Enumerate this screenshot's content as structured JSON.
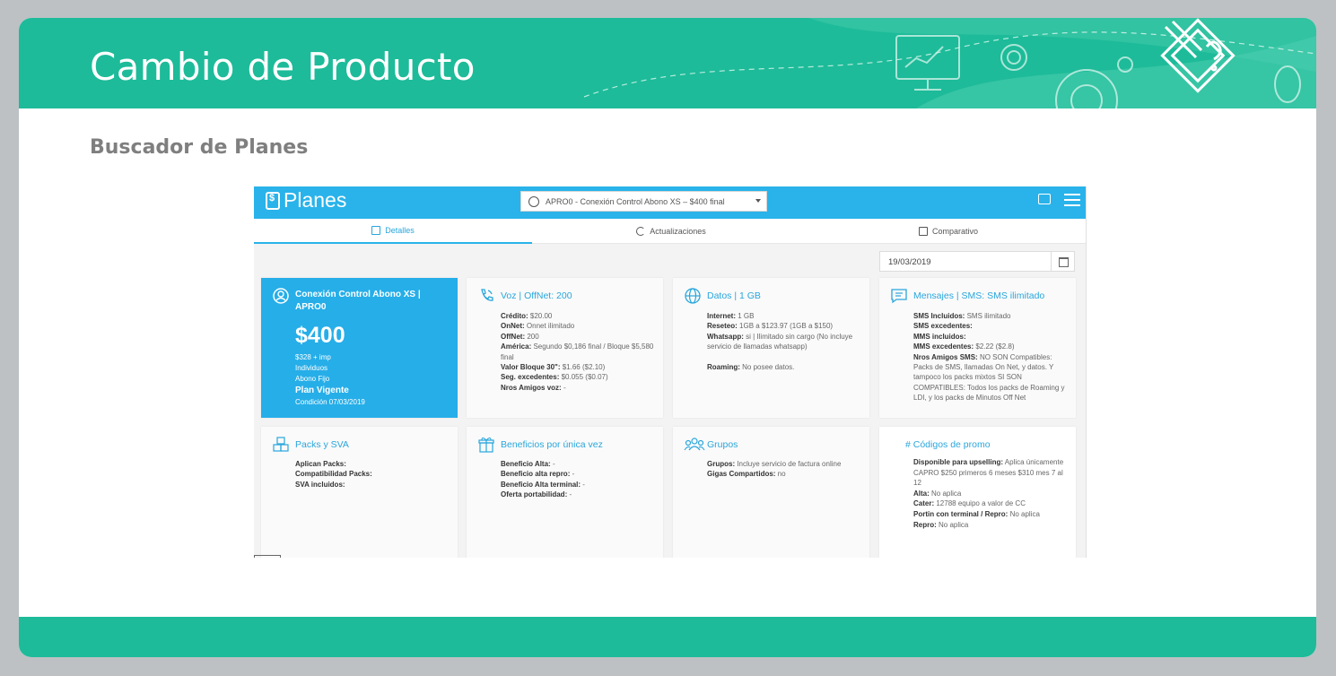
{
  "slide": {
    "title": "Cambio de Producto",
    "subtitle": "Buscador de Planes"
  },
  "app": {
    "brand": "Planes",
    "plan_select": "APRO0 - Conexión Control Abono XS – $400 final",
    "tabs": [
      {
        "label": "Detalles",
        "active": true
      },
      {
        "label": "Actualizaciones",
        "active": false
      },
      {
        "label": "Comparativo",
        "active": false
      }
    ],
    "date": "19/03/2019",
    "plan": {
      "name": "Conexión Control Abono XS | APRO0",
      "price": "$400",
      "net": "$328 + imp",
      "segment": "Individuos",
      "type": "Abono Fijo",
      "status": "Plan Vigente",
      "condition": "Condición 07/03/2019"
    },
    "voz": {
      "title": "Voz | OffNet: 200",
      "rows": [
        {
          "k": "Crédito:",
          "v": " $20.00"
        },
        {
          "k": "OnNet:",
          "v": " Onnet ilimitado"
        },
        {
          "k": "OffNet:",
          "v": " 200"
        },
        {
          "k": "América:",
          "v": " Segundo $0,186 final / Bloque $5,580 final"
        },
        {
          "k": "Valor Bloque 30\":",
          "v": " $1.66 ($2.10)"
        },
        {
          "k": "Seg. excedentes:",
          "v": " $0.055 ($0.07)"
        },
        {
          "k": "Nros Amigos voz:",
          "v": " -"
        }
      ]
    },
    "datos": {
      "title": "Datos | 1 GB",
      "rows": [
        {
          "k": "Internet:",
          "v": " 1 GB"
        },
        {
          "k": "Reseteo:",
          "v": " 1GB a $123.97 (1GB a $150)"
        },
        {
          "k": "Whatsapp:",
          "v": " si | Ilimitado sin cargo (No incluye servicio de llamadas whatsapp)"
        },
        {
          "k": "Roaming:",
          "v": " No posee datos."
        }
      ]
    },
    "mensajes": {
      "title": "Mensajes | SMS: SMS ilimitado",
      "rows": [
        {
          "k": "SMS Incluidos:",
          "v": " SMS ilimitado"
        },
        {
          "k": "SMS excedentes:",
          "v": ""
        },
        {
          "k": "MMS incluidos:",
          "v": ""
        },
        {
          "k": "MMS excedentes:",
          "v": " $2.22 ($2.8)"
        },
        {
          "k": "Nros Amigos SMS:",
          "v": " NO SON Compatibles: Packs de SMS, llamadas On Net, y datos. Y tampoco los packs mixtos SI SON COMPATIBLES: Todos los packs de Roaming y LDI, y los packs de Minutos Off Net"
        }
      ]
    },
    "packs": {
      "title": "Packs y SVA",
      "rows": [
        {
          "k": "Aplican Packs:",
          "v": ""
        },
        {
          "k": "Compatibilidad Packs:",
          "v": ""
        },
        {
          "k": "SVA incluidos:",
          "v": ""
        }
      ]
    },
    "beneficios": {
      "title": "Beneficios por única vez",
      "rows": [
        {
          "k": "Beneficio Alta:",
          "v": " -"
        },
        {
          "k": "Beneficio alta repro:",
          "v": " -"
        },
        {
          "k": "Beneficio Alta terminal:",
          "v": " -"
        },
        {
          "k": "Oferta portabilidad:",
          "v": " -"
        }
      ]
    },
    "grupos": {
      "title": "Grupos",
      "rows": [
        {
          "k": "Grupos:",
          "v": " Incluye servicio de factura online"
        },
        {
          "k": "Gigas Compartidos:",
          "v": " no"
        }
      ]
    },
    "promo": {
      "title": "# Códigos de promo",
      "rows": [
        {
          "k": "Disponible para upselling:",
          "v": " Aplica únicamente CAPRO $250 primeros 6 meses $310 mes 7 al 12"
        },
        {
          "k": "Alta:",
          "v": " No aplica"
        },
        {
          "k": "Cater:",
          "v": " 12788 equipo a valor de CC"
        },
        {
          "k": "Portin con terminal / Repro:",
          "v": " No aplica"
        },
        {
          "k": "Repro:",
          "v": " No aplica"
        }
      ]
    }
  },
  "colors": {
    "teal": "#1dbb99",
    "blue": "#29b3ea",
    "accent_text": "#29a6dc"
  }
}
